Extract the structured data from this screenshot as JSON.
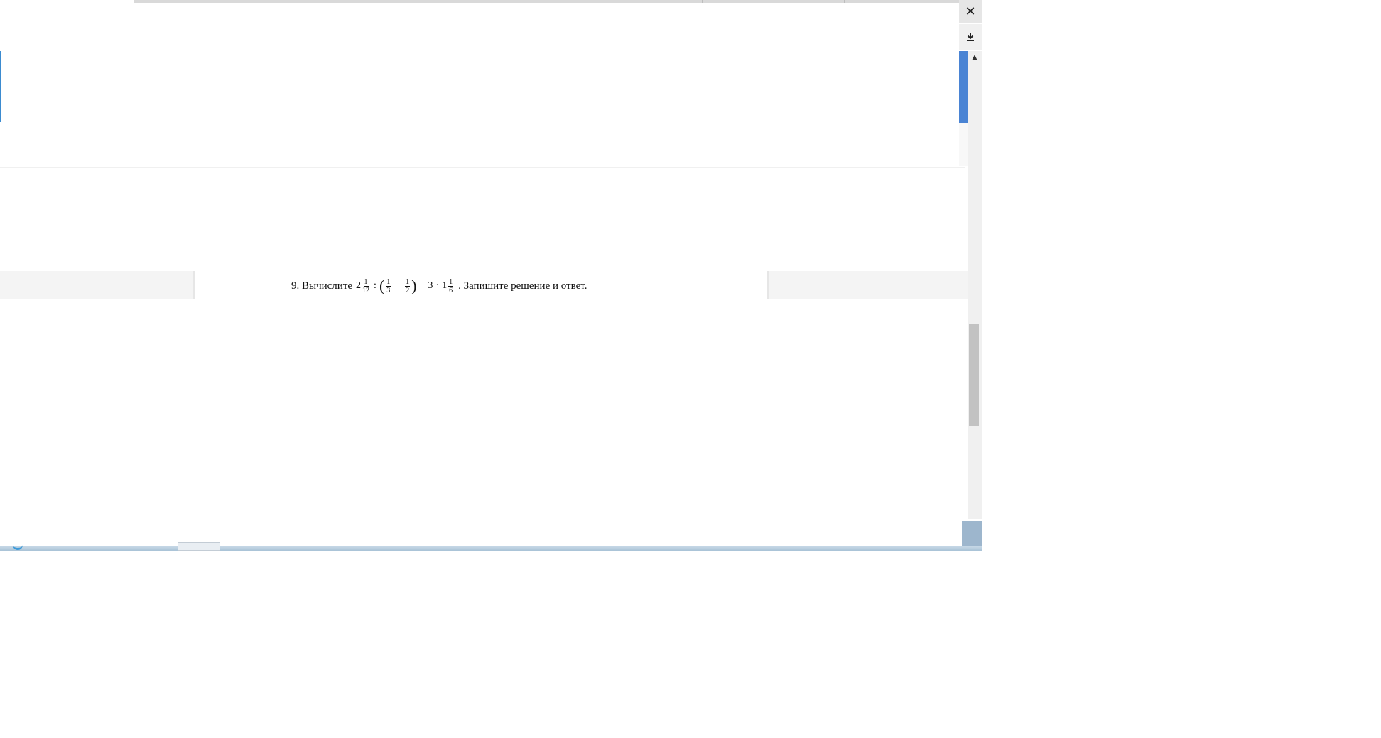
{
  "document": {
    "problem_prefix": "9. Вычислите",
    "expression": {
      "whole1": "2",
      "frac1_num": "1",
      "frac1_den": "12",
      "divide": ":",
      "paren_open": "(",
      "frac2_num": "1",
      "frac2_den": "3",
      "minus1": "−",
      "frac3_num": "1",
      "frac3_den": "2",
      "paren_close": ")",
      "minus2": "−",
      "three": "3",
      "dot": "·",
      "whole2": "1",
      "frac4_num": "1",
      "frac4_den": "6"
    },
    "problem_suffix": ". Запишите решение и ответ."
  },
  "toolbar": {
    "close_icon": "close-icon",
    "close_glyph": "✕",
    "download_icon": "download-icon"
  },
  "scrollbar": {
    "up_glyph": "▲"
  },
  "colors": {
    "accent": "#4a84d4",
    "band": "#f4f4f4",
    "taskbar": "#a9c2d6"
  }
}
